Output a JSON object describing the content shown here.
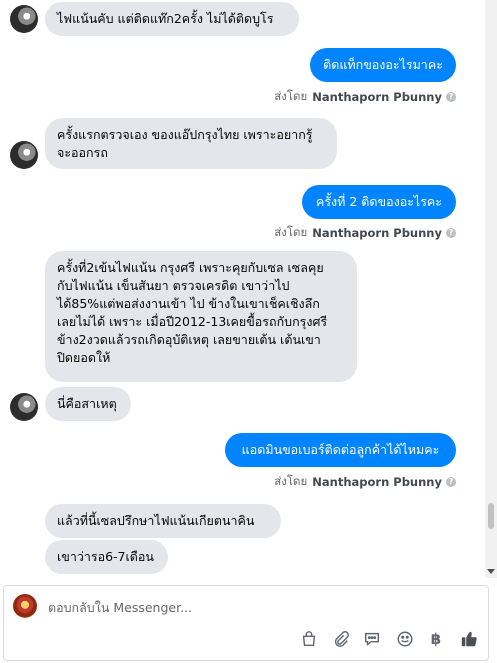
{
  "messages": [
    {
      "direction": "in",
      "text": "ไฟแน้นคับ แต่ติดแท๊ก2ครั้ง ไม่ได้ติดบูโร"
    },
    {
      "direction": "out",
      "text": "ติดแท็กของอะไรมาคะ"
    },
    {
      "direction": "in",
      "text": "ครั้งแรกตรวจเอง ของแอ๊ปกรุงไทย เพราะอยากรู้\nจะออกรถ"
    },
    {
      "direction": "out",
      "text": "ครั้งที่ 2 ติดของอะไรคะ"
    },
    {
      "direction": "in",
      "text": "ครั้งที่2เข้นไฟแน้น กรุงศรี เพราะคุยกับเซล เซลคุย\nกับไฟแน้น เข็นสันยา ตรวจเครดิต เขาว่าไป\nได้85%แต่พอส่งงานเข้า ไป ข้างในเขาเช็คเชิงลึก\nเลยไม่ได้ เพราะ เมื่อปี2012-13เคยขื้อรถกับกรุงศรี\nข้าง2งวดแล้วรถเกิดอุบัติเหตุ เลยขายเต้น เต้นเขา\nปิดยอดให้"
    },
    {
      "direction": "in",
      "text": "นี่คือสาเหตุ"
    },
    {
      "direction": "out",
      "text": "แอดมินขอเบอร์ติดต่อลูกค้าได้ไหมคะ"
    },
    {
      "direction": "in",
      "text": "แล้วที่นี้เซลปรึกษาไฟแน้นเกียตนาคิน"
    },
    {
      "direction": "in",
      "text": "เขาว่ารอ6-7เดือน"
    }
  ],
  "sent_by": {
    "prefix": "ส่งโดย",
    "name": "Nanthaporn Pbunny",
    "info_icon": "info-circle-icon"
  },
  "composer": {
    "placeholder": "ตอบกลับใน Messenger...",
    "value": "",
    "tools": [
      "shopping-bag-icon",
      "paperclip-icon",
      "quick-reply-icon",
      "emoji-icon",
      "baht-icon",
      "thumbs-up-icon"
    ]
  },
  "colors": {
    "outgoing": "#0084ff",
    "incoming": "#e4e6eb",
    "muted": "#65676b"
  }
}
